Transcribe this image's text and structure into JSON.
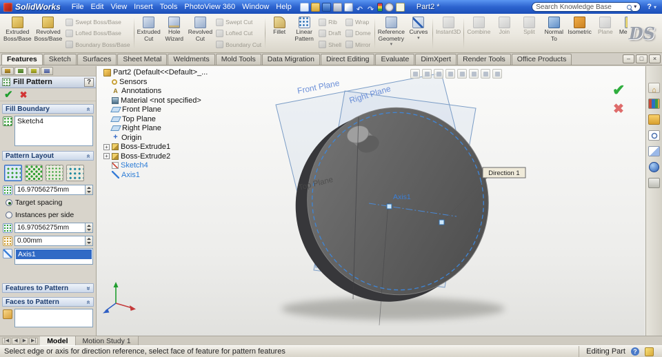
{
  "titlebar": {
    "app_name": "SolidWorks",
    "menus": [
      "File",
      "Edit",
      "View",
      "Insert",
      "Tools",
      "PhotoView 360",
      "Window",
      "Help"
    ],
    "toolbar_icons": [
      "new-document",
      "open",
      "save",
      "print",
      "select",
      "undo",
      "redo",
      "rebuild",
      "options",
      "help-topics"
    ],
    "document_title": "Part2 *",
    "search_placeholder": "Search Knowledge Base"
  },
  "branding": {
    "logo_text": "DS"
  },
  "icons": {
    "help": "?",
    "caret": "▾",
    "minimize": "–",
    "maximize": "□",
    "close": "×",
    "ok_check": "✔",
    "cancel_x": "✖",
    "chevron": "«",
    "expand": "+",
    "nav_first": "|◀",
    "nav_prev": "◀",
    "nav_next": "▶",
    "nav_last": "▶|"
  },
  "ribbon": {
    "groups": [
      {
        "items": [
          {
            "type": "large",
            "lines": [
              "Extruded",
              "Boss/Base"
            ],
            "icon": "extruded-boss-base-icon",
            "enabled": true
          },
          {
            "type": "large",
            "lines": [
              "Revolved",
              "Boss/Base"
            ],
            "icon": "revolved-boss-base-icon",
            "enabled": true
          },
          {
            "type": "stack",
            "items": [
              {
                "label": "Swept Boss/Base",
                "icon": "swept-boss-base-icon",
                "enabled": false
              },
              {
                "label": "Lofted Boss/Base",
                "icon": "lofted-boss-base-icon",
                "enabled": false
              },
              {
                "label": "Boundary Boss/Base",
                "icon": "boundary-boss-base-icon",
                "enabled": false
              }
            ]
          }
        ]
      },
      {
        "items": [
          {
            "type": "large",
            "lines": [
              "Extruded",
              "Cut"
            ],
            "icon": "extruded-cut-icon",
            "enabled": true
          },
          {
            "type": "large",
            "lines": [
              "Hole",
              "Wizard"
            ],
            "icon": "hole-wizard-icon",
            "enabled": true
          },
          {
            "type": "large",
            "lines": [
              "Revolved",
              "Cut"
            ],
            "icon": "revolved-cut-icon",
            "enabled": true
          },
          {
            "type": "stack",
            "items": [
              {
                "label": "Swept Cut",
                "icon": "swept-cut-icon",
                "enabled": false
              },
              {
                "label": "Lofted Cut",
                "icon": "lofted-cut-icon",
                "enabled": false
              },
              {
                "label": "Boundary Cut",
                "icon": "boundary-cut-icon",
                "enabled": false
              }
            ]
          }
        ]
      },
      {
        "items": [
          {
            "type": "large",
            "lines": [
              "Fillet"
            ],
            "icon": "fillet-icon",
            "enabled": true
          },
          {
            "type": "large",
            "lines": [
              "Linear",
              "Pattern"
            ],
            "icon": "linear-pattern-icon",
            "enabled": true
          },
          {
            "type": "stack",
            "items": [
              {
                "label": "Rib",
                "icon": "rib-icon",
                "enabled": false
              },
              {
                "label": "Draft",
                "icon": "draft-icon",
                "enabled": false
              },
              {
                "label": "Shell",
                "icon": "shell-icon",
                "enabled": false
              }
            ]
          },
          {
            "type": "stack",
            "items": [
              {
                "label": "Wrap",
                "icon": "wrap-icon",
                "enabled": false
              },
              {
                "label": "Dome",
                "icon": "dome-icon",
                "enabled": false
              },
              {
                "label": "Mirror",
                "icon": "mirror-icon",
                "enabled": false
              }
            ]
          }
        ]
      },
      {
        "items": [
          {
            "type": "large",
            "lines": [
              "Reference",
              "Geometry"
            ],
            "icon": "reference-geometry-icon",
            "enabled": true,
            "dropdown": true
          },
          {
            "type": "large",
            "lines": [
              "Curves"
            ],
            "icon": "curves-icon",
            "enabled": true,
            "dropdown": true
          }
        ]
      },
      {
        "items": [
          {
            "type": "large",
            "lines": [
              "Instant3D"
            ],
            "icon": "instant3d-icon",
            "enabled": false
          }
        ]
      },
      {
        "items": [
          {
            "type": "large",
            "lines": [
              "Combine"
            ],
            "icon": "combine-icon",
            "enabled": false
          },
          {
            "type": "large",
            "lines": [
              "Join"
            ],
            "icon": "join-icon",
            "enabled": false
          },
          {
            "type": "large",
            "lines": [
              "Split"
            ],
            "icon": "split-icon",
            "enabled": false
          },
          {
            "type": "large",
            "lines": [
              "Normal",
              "To"
            ],
            "icon": "normal-to-icon",
            "enabled": true
          },
          {
            "type": "large",
            "lines": [
              "Isometric"
            ],
            "icon": "isometric-icon",
            "enabled": true
          },
          {
            "type": "large",
            "lines": [
              "Plane"
            ],
            "icon": "plane-tool-icon",
            "enabled": false
          },
          {
            "type": "large",
            "lines": [
              "Measure"
            ],
            "icon": "measure-icon",
            "enabled": true
          }
        ]
      }
    ]
  },
  "command_tabs": {
    "active": 0,
    "items": [
      "Features",
      "Sketch",
      "Surfaces",
      "Sheet Metal",
      "Weldments",
      "Mold Tools",
      "Data Migration",
      "Direct Editing",
      "Evaluate",
      "DimXpert",
      "Render Tools",
      "Office Products"
    ]
  },
  "property_panel": {
    "panel_tabs": [
      "feature-manager-tab",
      "property-manager-tab",
      "configuration-manager-tab",
      "dimxpert-manager-tab"
    ],
    "title": "Fill Pattern",
    "fill_boundary": {
      "header": "Fill Boundary",
      "selection": "Sketch4"
    },
    "pattern_layout": {
      "header": "Pattern Layout",
      "target_spacing_value": "16.97056275mm",
      "target_spacing_radio": "Target spacing",
      "instances_radio": "Instances per side",
      "instance_spacing_value": "16.97056275mm",
      "margin_value": "0.00mm",
      "direction_reference": "Axis1"
    },
    "features_to_pattern": {
      "header": "Features to Pattern"
    },
    "faces_to_pattern": {
      "header": "Faces to Pattern"
    }
  },
  "feature_tree": {
    "root": "Part2  (Default<<Default>_...",
    "items": [
      {
        "label": "Sensors",
        "icon": "sensors-icon"
      },
      {
        "label": "Annotations",
        "icon": "annotations-icon"
      },
      {
        "label": "Material <not specified>",
        "icon": "material-icon"
      },
      {
        "label": "Front Plane",
        "icon": "plane-icon"
      },
      {
        "label": "Top Plane",
        "icon": "plane-icon"
      },
      {
        "label": "Right Plane",
        "icon": "plane-icon"
      },
      {
        "label": "Origin",
        "icon": "origin-icon"
      },
      {
        "label": "Boss-Extrude1",
        "icon": "boss-extrude-icon",
        "expand": true
      },
      {
        "label": "Boss-Extrude2",
        "icon": "boss-extrude-icon",
        "expand": true
      },
      {
        "label": "Sketch4",
        "icon": "sketch-icon",
        "selected": true
      },
      {
        "label": "Axis1",
        "icon": "axis-icon",
        "selected": true
      }
    ]
  },
  "viewport": {
    "front_plane_label": "Front Plane",
    "right_plane_label": "Right Plane",
    "top_plane_label": "Top Plane",
    "axis_label": "Axis1",
    "direction_callout": "Direction 1",
    "view_toolbar_icons": [
      "zoom-fit",
      "zoom-to-area",
      "previous-view",
      "section-view",
      "view-orientation",
      "display-style",
      "hide-show-items",
      "edit-appearance"
    ]
  },
  "task_pane": {
    "icons": [
      "solidworks-resources",
      "design-library",
      "file-explorer",
      "search",
      "view-palette",
      "appearances",
      "custom-properties"
    ]
  },
  "bottom_bar": {
    "tabs": [
      {
        "label": "Model",
        "active": true
      },
      {
        "label": "Motion Study 1",
        "active": false
      }
    ]
  },
  "status_bar": {
    "message": "Select edge or axis for direction reference, select face of feature for pattern features",
    "mode": "Editing Part"
  }
}
